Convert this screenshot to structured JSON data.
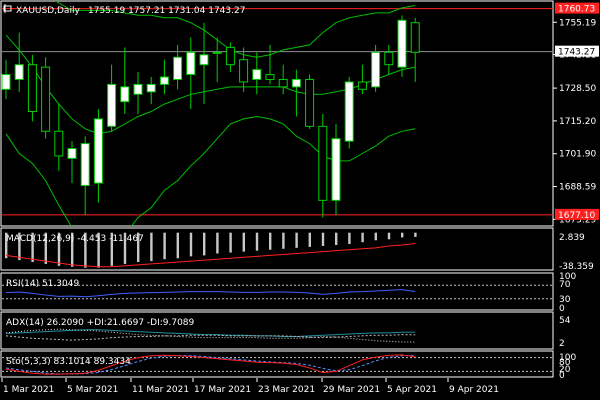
{
  "colors": {
    "background": "#000000",
    "frame": "#ffffff",
    "bull_candle": "#ffffff",
    "bear_candle": "#ffffff",
    "wick": "#00d000",
    "bands": "#00c000",
    "level_line": "#ff2020",
    "current_price_tag": "#ffffff",
    "macd_signal": "#ff2020",
    "rsi": "#4060ff",
    "adx_dotted": "#c0c0c0",
    "adx_plus": "#1f8fa0",
    "sto_main": "#ff2020",
    "sto_signal": "#5a8cff"
  },
  "header": {
    "symbol_icon": "chart-icon",
    "title": "XAUUSD,Daily",
    "ohlc": "1755.19 1757.21 1731.04 1743.27"
  },
  "price_axis": {
    "ticks": [
      "1755.19",
      "1742.11",
      "1728.50",
      "1715.20",
      "1701.90",
      "1688.59",
      "1675.29"
    ],
    "high_tag": "1760.73",
    "current_tag": "1743.27",
    "low_tag": "1677.10"
  },
  "macd_panel": {
    "label": "MACD(12,26,9) -4.453 -11.467",
    "ticks": [
      "2.839",
      "-38.359"
    ]
  },
  "rsi_panel": {
    "label": "RSI(14) 51.3049",
    "ticks": [
      "100",
      "70",
      "30",
      "0"
    ]
  },
  "adx_panel": {
    "label": "ADX(14) 26.2090 +DI:21.6697 -DI:9.7089",
    "ticks": [
      "54",
      "2"
    ]
  },
  "sto_panel": {
    "label": "Sto(5,3,3) 83.1014 89.3434",
    "ticks": [
      "100",
      "80",
      "20",
      "0"
    ]
  },
  "date_axis": {
    "labels": [
      "1 Mar 2021",
      "5 Mar 2021",
      "11 Mar 2021",
      "17 Mar 2021",
      "23 Mar 2021",
      "29 Mar 2021",
      "5 Apr 2021",
      "9 Apr 2021"
    ]
  },
  "chart_data": {
    "type": "candlestick",
    "symbol": "XAUUSD",
    "timeframe": "Daily",
    "ylim": [
      1673,
      1763
    ],
    "candles": [
      {
        "o": 1728,
        "h": 1740,
        "l": 1724,
        "c": 1734
      },
      {
        "o": 1732,
        "h": 1751,
        "l": 1727,
        "c": 1738
      },
      {
        "o": 1738,
        "h": 1742,
        "l": 1715,
        "c": 1719
      },
      {
        "o": 1737,
        "h": 1741,
        "l": 1708,
        "c": 1711
      },
      {
        "o": 1711,
        "h": 1722,
        "l": 1695,
        "c": 1701
      },
      {
        "o": 1700,
        "h": 1707,
        "l": 1690,
        "c": 1704
      },
      {
        "o": 1689,
        "h": 1709,
        "l": 1677,
        "c": 1706
      },
      {
        "o": 1690,
        "h": 1720,
        "l": 1682,
        "c": 1716
      },
      {
        "o": 1713,
        "h": 1738,
        "l": 1711,
        "c": 1730
      },
      {
        "o": 1723,
        "h": 1745,
        "l": 1718,
        "c": 1729
      },
      {
        "o": 1726,
        "h": 1735,
        "l": 1718,
        "c": 1730
      },
      {
        "o": 1727,
        "h": 1733,
        "l": 1722,
        "c": 1730
      },
      {
        "o": 1730,
        "h": 1740,
        "l": 1726,
        "c": 1733
      },
      {
        "o": 1732,
        "h": 1746,
        "l": 1728,
        "c": 1741
      },
      {
        "o": 1734,
        "h": 1749,
        "l": 1720,
        "c": 1743
      },
      {
        "o": 1738,
        "h": 1755,
        "l": 1722,
        "c": 1742
      },
      {
        "o": 1743,
        "h": 1749,
        "l": 1731,
        "c": 1743
      },
      {
        "o": 1745,
        "h": 1747,
        "l": 1735,
        "c": 1738
      },
      {
        "o": 1740,
        "h": 1745,
        "l": 1727,
        "c": 1731
      },
      {
        "o": 1732,
        "h": 1743,
        "l": 1726,
        "c": 1736
      },
      {
        "o": 1734,
        "h": 1746,
        "l": 1730,
        "c": 1732
      },
      {
        "o": 1732,
        "h": 1738,
        "l": 1726,
        "c": 1729
      },
      {
        "o": 1729,
        "h": 1736,
        "l": 1717,
        "c": 1732
      },
      {
        "o": 1732,
        "h": 1734,
        "l": 1712,
        "c": 1713
      },
      {
        "o": 1713,
        "h": 1718,
        "l": 1676,
        "c": 1683
      },
      {
        "o": 1683,
        "h": 1714,
        "l": 1677,
        "c": 1708
      },
      {
        "o": 1707,
        "h": 1733,
        "l": 1704,
        "c": 1731
      },
      {
        "o": 1731,
        "h": 1738,
        "l": 1726,
        "c": 1728
      },
      {
        "o": 1729,
        "h": 1746,
        "l": 1727,
        "c": 1743
      },
      {
        "o": 1743,
        "h": 1746,
        "l": 1734,
        "c": 1738
      },
      {
        "o": 1737,
        "h": 1758,
        "l": 1733,
        "c": 1756
      },
      {
        "o": 1755,
        "h": 1757,
        "l": 1731,
        "c": 1743
      }
    ],
    "bollinger": {
      "upper": [
        1790,
        1786,
        1776,
        1767,
        1763,
        1760,
        1760,
        1760,
        1760,
        1759,
        1758,
        1758,
        1757,
        1757,
        1755,
        1752,
        1748,
        1744,
        1742,
        1741,
        1742,
        1744,
        1745,
        1746,
        1751,
        1755,
        1757,
        1758,
        1759,
        1759,
        1761,
        1762
      ],
      "middle": [
        1750,
        1744,
        1737,
        1729,
        1722,
        1716,
        1712,
        1710,
        1711,
        1714,
        1717,
        1719,
        1722,
        1724,
        1726,
        1727,
        1728,
        1729,
        1729,
        1729,
        1729,
        1729,
        1727,
        1726,
        1726,
        1727,
        1728,
        1730,
        1732,
        1734,
        1736,
        1737
      ],
      "lower": [
        1710,
        1702,
        1698,
        1691,
        1681,
        1672,
        1664,
        1660,
        1662,
        1669,
        1676,
        1680,
        1687,
        1691,
        1697,
        1702,
        1708,
        1714,
        1716,
        1717,
        1716,
        1714,
        1709,
        1706,
        1701,
        1699,
        1699,
        1702,
        1705,
        1709,
        1711,
        1712
      ]
    },
    "levels": {
      "high": 1760.73,
      "low": 1677.1,
      "current": 1743.27
    },
    "macd": {
      "ylim": [
        -38.359,
        2.839
      ],
      "histogram": [
        -27,
        -29,
        -31,
        -33,
        -35,
        -36,
        -37,
        -37,
        -35,
        -33,
        -31,
        -30,
        -28,
        -27,
        -25,
        -24,
        -22,
        -21,
        -20,
        -19,
        -18,
        -17,
        -16,
        -15,
        -14,
        -13,
        -12,
        -10,
        -8,
        -7,
        -5,
        -4.453
      ],
      "signal": [
        -24,
        -26,
        -28,
        -30,
        -32,
        -34,
        -35,
        -36,
        -36,
        -35,
        -34,
        -33,
        -32,
        -31,
        -30,
        -29,
        -28,
        -27,
        -26,
        -25,
        -24,
        -23,
        -22,
        -21,
        -20,
        -19,
        -18,
        -17,
        -16,
        -14,
        -13,
        -11.467
      ]
    },
    "rsi": {
      "ylim": [
        0,
        100
      ],
      "levels": [
        70,
        30
      ],
      "values": [
        48,
        50,
        46,
        41,
        37,
        38,
        36,
        39,
        43,
        46,
        47,
        48,
        49,
        50,
        51,
        51,
        51,
        50,
        49,
        49,
        50,
        50,
        49,
        47,
        43,
        46,
        50,
        51,
        53,
        55,
        57,
        51.3049
      ]
    },
    "adx": {
      "ylim": [
        0,
        56
      ],
      "adx": [
        24,
        25,
        26,
        27,
        28,
        29,
        30,
        30,
        29,
        28,
        27,
        26,
        25,
        24,
        23,
        22,
        22,
        21,
        21,
        20,
        20,
        19,
        19,
        20,
        21,
        22,
        23,
        24,
        25,
        25,
        26,
        26.209
      ],
      "plus_di": [
        20,
        18,
        16,
        15,
        14,
        13,
        14,
        15,
        17,
        18,
        19,
        19,
        20,
        20,
        21,
        21,
        21,
        20,
        20,
        20,
        20,
        20,
        19,
        18,
        17,
        18,
        19,
        20,
        21,
        21,
        22,
        21.6697
      ],
      "minus_di": [
        25,
        27,
        29,
        30,
        31,
        30,
        29,
        28,
        26,
        24,
        22,
        21,
        20,
        19,
        18,
        17,
        17,
        17,
        17,
        17,
        16,
        16,
        16,
        17,
        19,
        18,
        16,
        14,
        12,
        11,
        10,
        9.7089
      ]
    },
    "stochastic": {
      "ylim": [
        0,
        100
      ],
      "levels": [
        80,
        20
      ],
      "main": [
        30,
        20,
        12,
        8,
        8,
        10,
        12,
        25,
        45,
        65,
        80,
        88,
        90,
        88,
        85,
        80,
        75,
        70,
        65,
        60,
        58,
        56,
        50,
        35,
        15,
        20,
        45,
        70,
        82,
        90,
        92,
        83.1014
      ],
      "signal": [
        35,
        27,
        20,
        13,
        9,
        9,
        10,
        16,
        28,
        45,
        63,
        78,
        86,
        89,
        88,
        85,
        80,
        75,
        70,
        65,
        61,
        58,
        55,
        47,
        33,
        23,
        27,
        45,
        66,
        81,
        88,
        89.3434
      ]
    }
  }
}
